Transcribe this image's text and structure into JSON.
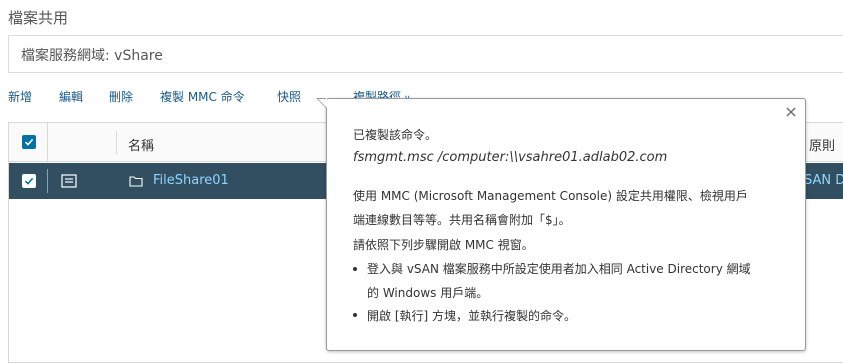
{
  "page": {
    "title": "檔案共用",
    "domain_label": "檔案服務網域: vShare"
  },
  "toolbar": {
    "add": "新增",
    "edit": "編輯",
    "delete": "刪除",
    "copy_mmc": "複製 MMC 命令",
    "snapshot": "快照",
    "copy_path": "複製路徑"
  },
  "grid": {
    "columns": {
      "name": "名稱",
      "policy": "原則"
    },
    "rows": [
      {
        "name": "FileShare01",
        "tail": "SAN D",
        "selected": true
      }
    ]
  },
  "popover": {
    "copied_msg": "已複製該命令。",
    "command": "fsmgmt.msc /computer:\\\\vsahre01.adlab02.com",
    "desc_line1": "使用 MMC (Microsoft Management Console) 設定共用權限、檢視用戶",
    "desc_line2": "端連線數目等等。共用名稱會附加「$」。",
    "steps_intro": "請依照下列步驟開啟 MMC 視窗。",
    "step1_line1": "登入與 vSAN 檔案服務中所設定使用者加入相同 Active Directory 網域",
    "step1_line2": "的 Windows 用戶端。",
    "step2": "開啟 [執行] 方塊，並執行複製的命令。"
  },
  "colors": {
    "accent": "#0072a3",
    "link": "#1a5a85",
    "row_selected_bg": "#324f61",
    "row_text": "#8fd6ff"
  },
  "icons": {
    "checkbox": "checkmark-icon",
    "details": "details-icon",
    "folder": "folder-icon",
    "close": "close-icon",
    "dropdown": "chevron-down-icon"
  }
}
